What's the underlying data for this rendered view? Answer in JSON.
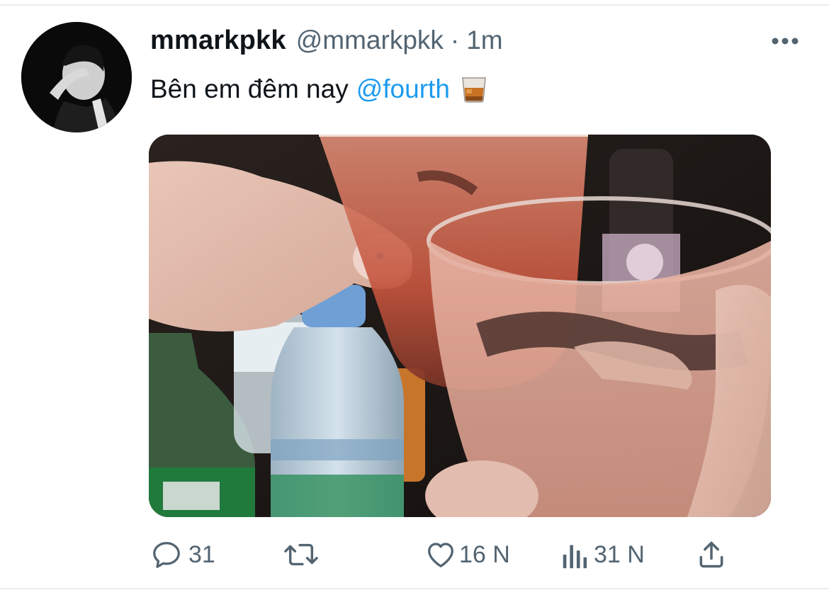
{
  "tweet": {
    "display_name": "mmarkpkk",
    "handle": "@mmarkpkk",
    "separator": "·",
    "time": "1m",
    "text": "Bên em đêm nay",
    "mention": "@fourth",
    "emoji": "tumbler-glass-emoji"
  },
  "icons": {
    "more": "more-horizontal-icon",
    "reply": "reply-icon",
    "retweet": "retweet-icon",
    "like": "heart-icon",
    "views": "views-icon",
    "share": "share-icon"
  },
  "actions": {
    "reply_count": "31",
    "retweet_count": "",
    "like_count": "16 N",
    "view_count": "31 N"
  },
  "colors": {
    "text": "#0f1419",
    "secondary": "#536471",
    "link": "#1d9bf0",
    "border": "#e8ecef"
  }
}
